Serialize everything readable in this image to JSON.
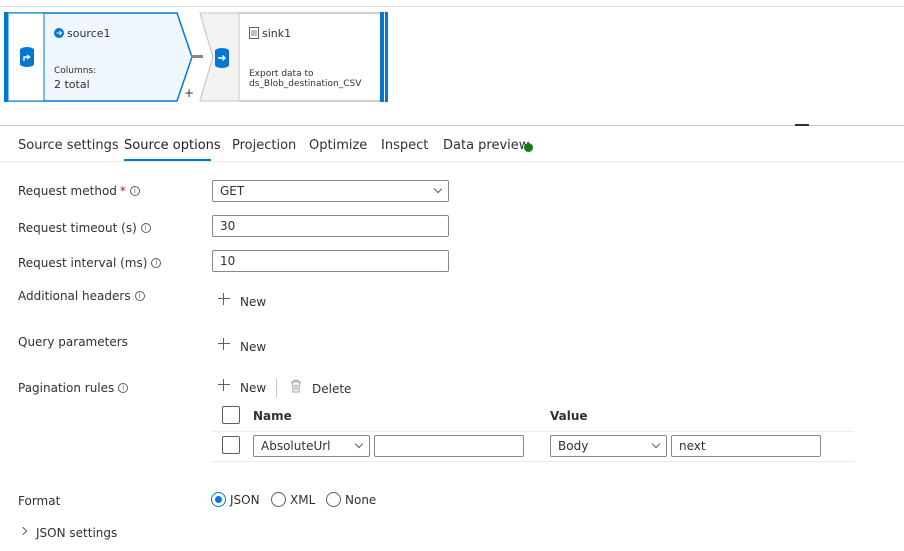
{
  "flow": {
    "source": {
      "title": "source1",
      "columns_label": "Columns:",
      "columns_value": "2 total"
    },
    "sink": {
      "title": "sink1",
      "description_line1": "Export data to",
      "description_line2": "ds_Blob_destination_CSV"
    },
    "add_label": "+"
  },
  "tabs": [
    {
      "label": "Source settings"
    },
    {
      "label": "Source options",
      "active": true
    },
    {
      "label": "Projection"
    },
    {
      "label": "Optimize"
    },
    {
      "label": "Inspect"
    },
    {
      "label": "Data preview",
      "status_color": "#107c10"
    }
  ],
  "form": {
    "request_method": {
      "label": "Request method",
      "required_mark": "*",
      "value": "GET"
    },
    "request_timeout": {
      "label": "Request timeout (s)",
      "value": "30"
    },
    "request_interval": {
      "label": "Request interval (ms)",
      "value": "10"
    },
    "additional_headers": {
      "label": "Additional headers",
      "new_label": "New"
    },
    "query_parameters": {
      "label": "Query parameters",
      "new_label": "New"
    },
    "pagination_rules": {
      "label": "Pagination rules",
      "new_label": "New",
      "delete_label": "Delete",
      "columns": {
        "name": "Name",
        "value": "Value"
      },
      "rows": [
        {
          "name_type": "AbsoluteUrl",
          "name_value": "",
          "value_type": "Body",
          "value": "next"
        }
      ]
    },
    "format": {
      "label": "Format",
      "options": [
        "JSON",
        "XML",
        "None"
      ],
      "selected": "JSON"
    },
    "json_settings": {
      "label": "JSON settings"
    }
  },
  "info_glyph": "i",
  "colors": {
    "accent": "#0078d4",
    "status_ok": "#107c10"
  }
}
